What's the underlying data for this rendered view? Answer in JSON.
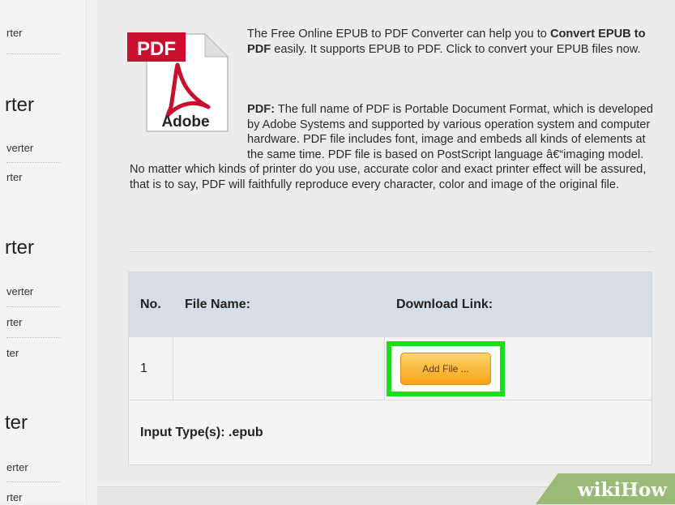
{
  "sidebar": {
    "links": [
      "rter",
      "verter",
      "rter",
      "verter",
      "rter",
      "ter",
      "erter",
      "rter"
    ],
    "headings": [
      "rter",
      "rter",
      "ter"
    ]
  },
  "logo": {
    "badge": "PDF",
    "brand": "Adobe"
  },
  "intro": {
    "part1": "The Free Online EPUB to PDF Converter can help you to ",
    "bold": "Convert EPUB to PDF",
    "part2": " easily. It supports EPUB to PDF. Click to convert your EPUB files now."
  },
  "description": {
    "label": "PDF:",
    "text": " The full name of PDF is Portable Document Format, which is developed by Adobe Systems and supported by various operation system and computer hardware. PDF file includes font, image and embeds all kinds of elements at the same time. PDF file is based on PostScript language â€“imaging model. No matter which kinds of printer do you use, accurate color and exact printer effect will be assured, that is to say, PDF will faithfully reproduce every character, color and image of the original file."
  },
  "table": {
    "headers": [
      "No.",
      "File Name:",
      "Download Link:"
    ],
    "row": {
      "no": "1",
      "file_name": "",
      "button": "Add File ..."
    },
    "input_type": "Input Type(s): .epub"
  },
  "watermark": {
    "part1": "wiki",
    "part2": "How"
  },
  "colors": {
    "highlight": "#17e01a",
    "button": "#f5a316",
    "header_bg": "#d5dde6",
    "pdf_red": "#c8102e"
  }
}
